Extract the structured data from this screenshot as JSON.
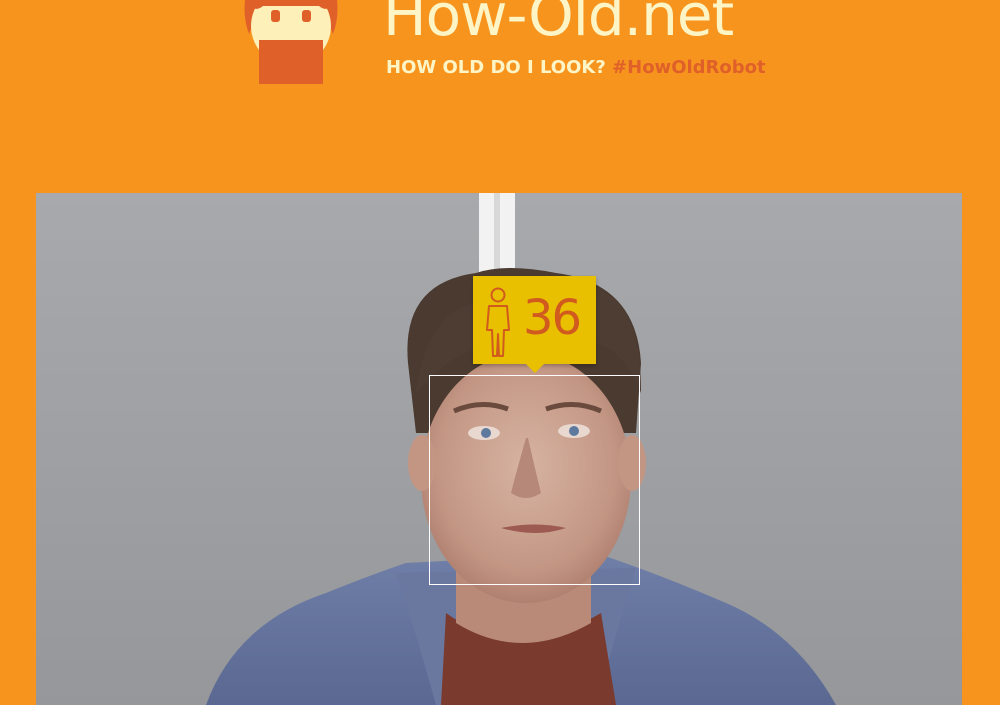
{
  "header": {
    "title": "How-Old.net",
    "tagline": "HOW OLD DO I LOOK?",
    "hashtag": "#HowOldRobot"
  },
  "detection": {
    "age": "36",
    "gender_icon": "male-person-icon"
  },
  "colors": {
    "background": "#f7941e",
    "title_text": "#fdf5c6",
    "hashtag_text": "#e0602a",
    "badge_background": "#e8c000",
    "badge_text": "#d15a1e",
    "face_box_border": "#ffffff"
  }
}
